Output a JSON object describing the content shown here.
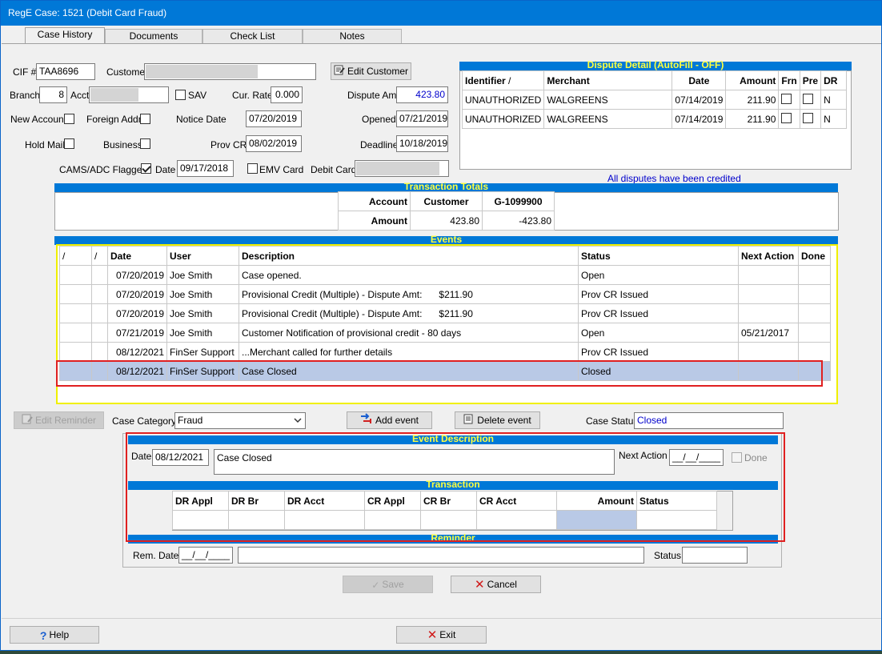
{
  "window": {
    "title": "RegE Case: 1521 (Debit Card Fraud)"
  },
  "tabs": [
    {
      "label": "Case History",
      "active": true
    },
    {
      "label": "Documents",
      "active": false
    },
    {
      "label": "Check List",
      "active": false
    },
    {
      "label": "Notes",
      "active": false
    }
  ],
  "form": {
    "cif_label": "CIF #",
    "cif_value": "TAA8696",
    "customer_label": "Customer",
    "customer_value": "",
    "edit_customer_label": "Edit Customer",
    "branch_label": "Branch",
    "branch_value": "8",
    "acct_label": "Acct",
    "acct_value": "",
    "sav_label": "SAV",
    "cur_rate_label": "Cur. Rate",
    "cur_rate_value": "0.000",
    "dispute_amt_label": "Dispute Amt",
    "dispute_amt_value": "423.80",
    "new_account_label": "New Account",
    "foreign_addr_label": "Foreign Addr",
    "notice_date_label": "Notice Date",
    "notice_date_value": "07/20/2019",
    "opened_label": "Opened",
    "opened_value": "07/21/2019",
    "hold_mail_label": "Hold Mail",
    "business_label": "Business",
    "prov_cr_label": "Prov CR",
    "prov_cr_value": "08/02/2019",
    "deadline_label": "Deadline",
    "deadline_value": "10/18/2019",
    "cams_label": "CAMS/ADC Flagged",
    "cams_checked": true,
    "date_label": "Date",
    "date_value": "09/17/2018",
    "emv_label": "EMV Card",
    "debit_card_label": "Debit Card",
    "debit_card_value": ""
  },
  "dispute": {
    "title": "Dispute Detail (AutoFill - OFF)",
    "headers": [
      "Identifier",
      "Merchant",
      "Date",
      "Amount",
      "Frn",
      "Pre",
      "DR"
    ],
    "rows": [
      [
        "UNAUTHORIZED",
        "WALGREENS",
        "07/14/2019",
        "211.90",
        "",
        "",
        "N"
      ],
      [
        "UNAUTHORIZED",
        "WALGREENS",
        "07/14/2019",
        "211.90",
        "",
        "",
        "N"
      ]
    ],
    "note": "All disputes have been credited"
  },
  "totals": {
    "title": "Transaction Totals",
    "headers": [
      "Account",
      "Customer",
      "G-1099900"
    ],
    "row_label": "Amount",
    "values": [
      "423.80",
      "-423.80"
    ]
  },
  "events": {
    "title": "Events",
    "headers": [
      "/",
      "/",
      "Date",
      "User",
      "Description",
      "Status",
      "Next Action",
      "Done"
    ],
    "rows": [
      [
        "",
        "",
        "07/20/2019",
        "Joe Smith",
        "Case opened.",
        "",
        "Open",
        "",
        ""
      ],
      [
        "",
        "",
        "07/20/2019",
        "Joe Smith",
        "Provisional Credit (Multiple) - Dispute Amt:",
        "$211.90",
        "Prov CR Issued",
        "",
        ""
      ],
      [
        "",
        "",
        "07/20/2019",
        "Joe Smith",
        "Provisional Credit (Multiple) - Dispute Amt:",
        "$211.90",
        "Prov CR Issued",
        "",
        ""
      ],
      [
        "",
        "",
        "07/21/2019",
        "Joe Smith",
        "Customer Notification of provisional credit - 80 days",
        "",
        "Open",
        "05/21/2017",
        ""
      ],
      [
        "",
        "",
        "08/12/2021",
        "FinSer Support",
        "...Merchant called for further details",
        "",
        "Prov CR Issued",
        "",
        ""
      ],
      [
        "",
        "",
        "08/12/2021",
        "FinSer Support",
        "Case Closed",
        "",
        "Closed",
        "",
        ""
      ]
    ],
    "selected_index": 5
  },
  "actions": {
    "edit_reminder_label": "Edit Reminder",
    "case_category_label": "Case Category",
    "case_category_value": "Fraud",
    "add_event_label": "Add event",
    "delete_event_label": "Delete event",
    "case_status_label": "Case Status",
    "case_status_value": "Closed"
  },
  "event_desc": {
    "title": "Event Description",
    "date_label": "Date",
    "date_value": "08/12/2021",
    "desc_value": "Case Closed",
    "next_action_label": "Next Action",
    "next_action_value": "__/__/____",
    "done_label": "Done"
  },
  "transaction": {
    "title": "Transaction",
    "headers": [
      "DR Appl",
      "DR Br",
      "DR Acct",
      "CR Appl",
      "CR Br",
      "CR Acct",
      "Amount",
      "Status"
    ]
  },
  "reminder": {
    "title": "Reminder",
    "rem_date_label": "Rem. Date",
    "rem_date_value": "__/__/____",
    "status_label": "Status"
  },
  "buttons": {
    "save_label": "Save",
    "cancel_label": "Cancel",
    "help_label": "Help",
    "exit_label": "Exit"
  }
}
